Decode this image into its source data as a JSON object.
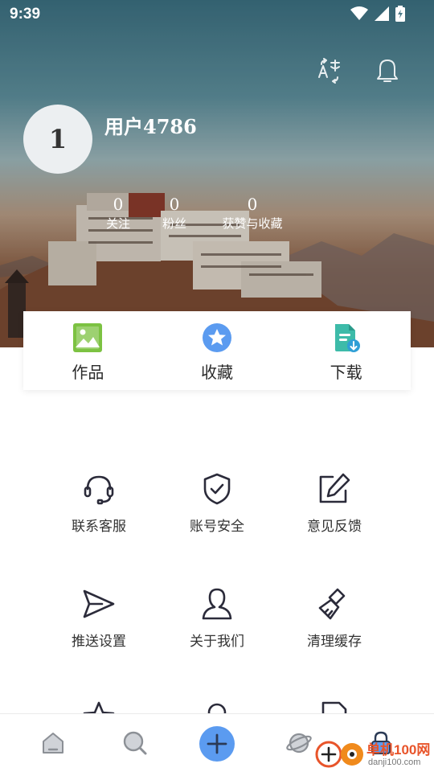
{
  "status_bar": {
    "time": "9:39"
  },
  "profile": {
    "avatar_text": "1",
    "username": "用户4786",
    "stats": [
      {
        "value": "0",
        "label": "关注"
      },
      {
        "value": "0",
        "label": "粉丝"
      },
      {
        "value": "0",
        "label": "获赞与收藏"
      }
    ]
  },
  "header_actions": [
    "translate-icon",
    "bell-icon"
  ],
  "card_tabs": [
    {
      "label": "作品",
      "icon": "gallery-icon",
      "color": "#7cc242"
    },
    {
      "label": "收藏",
      "icon": "star-badge-icon",
      "color": "#5b9bf0"
    },
    {
      "label": "下载",
      "icon": "file-download-icon",
      "color": "#3dbba9"
    }
  ],
  "menu": [
    {
      "label": "联系客服",
      "icon": "headset-icon"
    },
    {
      "label": "账号安全",
      "icon": "shield-icon"
    },
    {
      "label": "意见反馈",
      "icon": "edit-icon"
    },
    {
      "label": "推送设置",
      "icon": "send-icon"
    },
    {
      "label": "关于我们",
      "icon": "user-icon"
    },
    {
      "label": "清理缓存",
      "icon": "brush-icon"
    }
  ],
  "bottom_nav": [
    "home-icon",
    "search-icon",
    "plus-icon",
    "planet-icon",
    "lock-icon"
  ],
  "colors": {
    "accent": "#5b9bf0",
    "green": "#7cc242",
    "teal": "#3dbba9",
    "icon_dark": "#2b2b3a"
  },
  "watermark": {
    "text": "单机100网",
    "url": "danji100.com"
  }
}
